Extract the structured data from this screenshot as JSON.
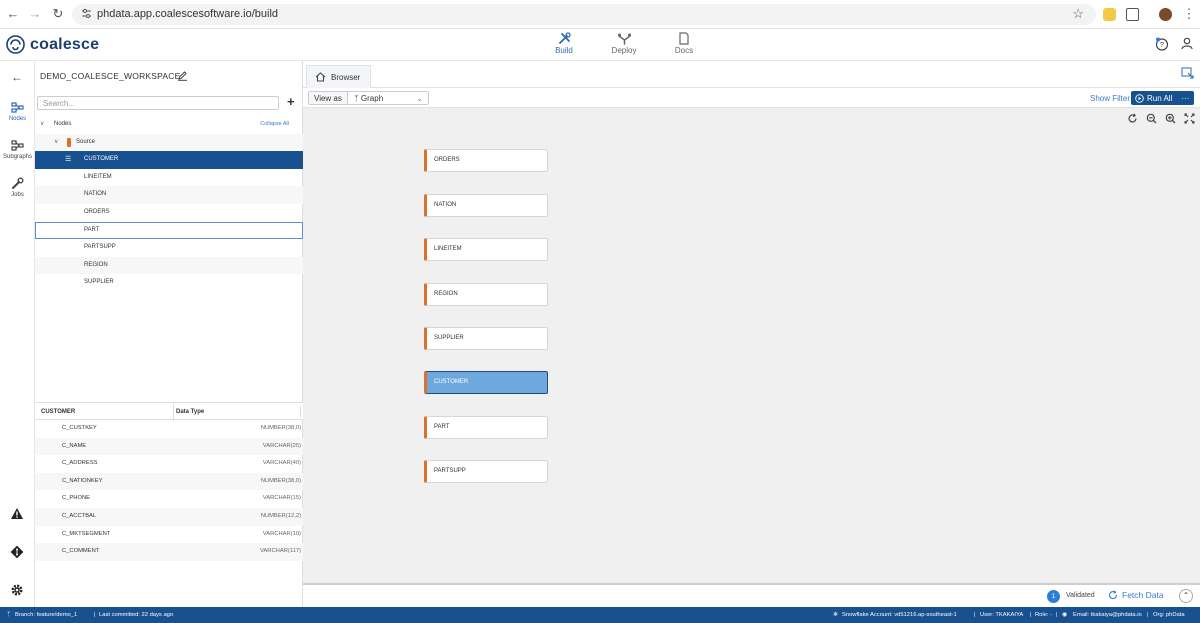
{
  "browser": {
    "url": "phdata.app.coalescesoftware.io/build",
    "extension_colors": [
      "#f3c94c",
      "#ffffff",
      "#7a4a2a"
    ]
  },
  "app": {
    "logo": "coalesce",
    "nav": [
      {
        "label": "Build",
        "icon": "build-icon",
        "active": true
      },
      {
        "label": "Deploy",
        "icon": "deploy-icon",
        "active": false
      },
      {
        "label": "Docs",
        "icon": "docs-icon",
        "active": false
      }
    ]
  },
  "rail": {
    "items": [
      {
        "label": "Nodes",
        "icon": "nodes-icon"
      },
      {
        "label": "Subgraphs",
        "icon": "subgraphs-icon"
      },
      {
        "label": "Jobs",
        "icon": "jobs-icon"
      }
    ]
  },
  "workspace": {
    "title": "DEMO_COALESCE_WORKSPACE",
    "search_placeholder": "Search..."
  },
  "tree": {
    "root": "Nodes",
    "collapse_all": "Collapse All",
    "group": "Source",
    "items": [
      "CUSTOMER",
      "LINEITEM",
      "NATION",
      "ORDERS",
      "PART",
      "PARTSUPP",
      "REGION",
      "SUPPLIER"
    ],
    "selected": "CUSTOMER"
  },
  "columns": {
    "header_name": "CUSTOMER",
    "header_type": "Data Type",
    "rows": [
      {
        "name": "C_CUSTKEY",
        "type": "NUMBER(38,0)"
      },
      {
        "name": "C_NAME",
        "type": "VARCHAR(25)"
      },
      {
        "name": "C_ADDRESS",
        "type": "VARCHAR(40)"
      },
      {
        "name": "C_NATIONKEY",
        "type": "NUMBER(38,0)"
      },
      {
        "name": "C_PHONE",
        "type": "VARCHAR(15)"
      },
      {
        "name": "C_ACCTBAL",
        "type": "NUMBER(12,2)"
      },
      {
        "name": "C_MKTSEGMENT",
        "type": "VARCHAR(10)"
      },
      {
        "name": "C_COMMENT",
        "type": "VARCHAR(117)"
      }
    ]
  },
  "main": {
    "tab": "Browser",
    "view_as_label": "View as",
    "view_as_value": "Graph",
    "show_filter": "Show Filter",
    "run_all": "Run All",
    "more": "···"
  },
  "graph": {
    "nodes": [
      "ORDERS",
      "NATION",
      "LINEITEM",
      "REGION",
      "SUPPLIER",
      "CUSTOMER",
      "PART",
      "PARTSUPP"
    ],
    "selected": "CUSTOMER",
    "node_color": "#d9732b"
  },
  "bottom": {
    "validated_count": "1",
    "validated_label": "Validated",
    "fetch_data": "Fetch Data"
  },
  "status": {
    "branch": "Branch: feature/demo_1",
    "last_committed": "Last committed: 22 days ago",
    "account": "Snowflake Account: vd51216.ap-southeast-1",
    "user": "User: TKAKAIYA",
    "role": "Role: -",
    "email": "Email: tkakaiya@phdata.io",
    "org": "Org: phData"
  }
}
